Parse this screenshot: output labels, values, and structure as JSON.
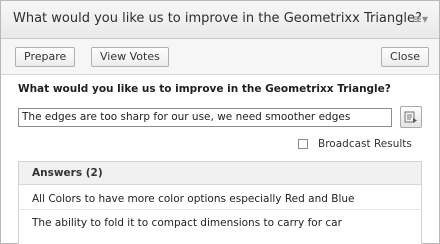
{
  "window": {
    "title": "What would you like us to improve in the Geometrixx Triangle?",
    "menu_icon": "menu-icon"
  },
  "toolbar": {
    "prepare_label": "Prepare",
    "view_votes_label": "View Votes",
    "close_label": "Close"
  },
  "question": {
    "text": "What would you like us to improve in the Geometrixx Triangle?"
  },
  "answer_input": {
    "value": "The edges are too sharp for our use, we need smoother edges"
  },
  "send_button": {
    "icon": "send-icon"
  },
  "broadcast": {
    "label": "Broadcast Results",
    "checked": false
  },
  "answers": {
    "header": "Answers (2)",
    "items": [
      "All Colors to have more color options especially Red and Blue",
      "The ability to fold it to compact dimensions to carry for car"
    ]
  },
  "colors": {
    "titlebar_bg": "#eeeeee",
    "panel_header_bg": "#f1f1f1",
    "border": "#b8b8b8"
  }
}
